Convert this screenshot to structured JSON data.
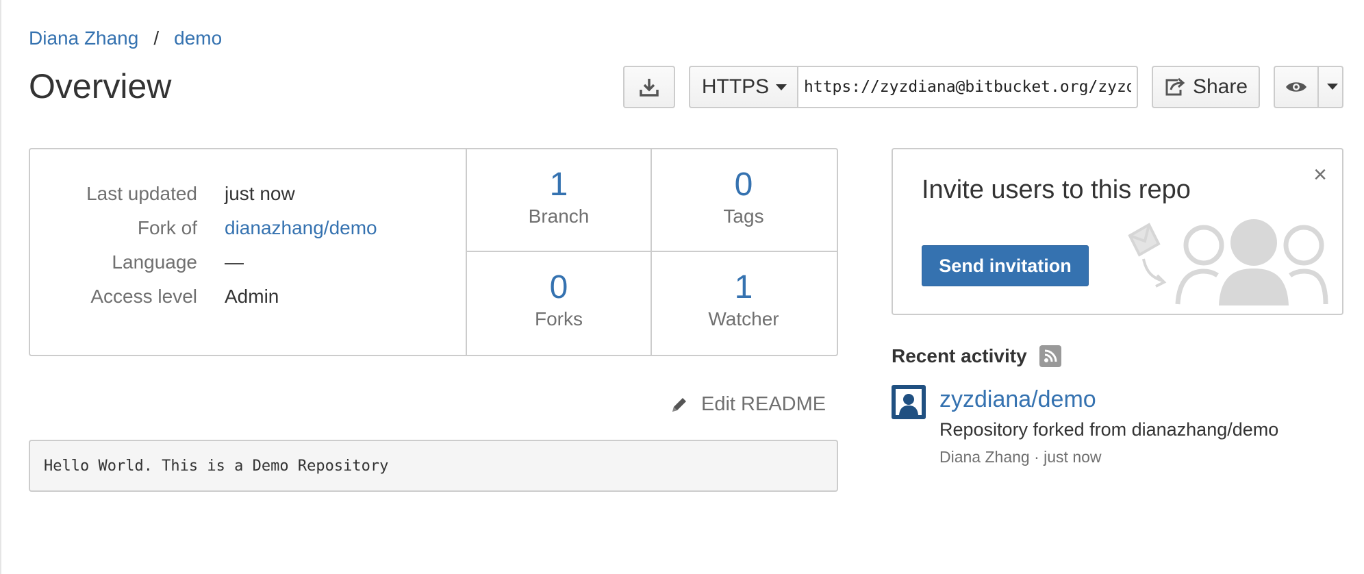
{
  "breadcrumb": {
    "owner": "Diana Zhang",
    "separator": "/",
    "repo": "demo"
  },
  "page_title": "Overview",
  "toolbar": {
    "protocol": "HTTPS",
    "clone_url": "https://zyzdiana@bitbucket.org/zyzdiana/demo.git",
    "share_label": "Share"
  },
  "repo_meta": [
    {
      "label": "Last updated",
      "value": "just now"
    },
    {
      "label": "Fork of",
      "value": "dianazhang/demo"
    },
    {
      "label": "Language",
      "value": "—"
    },
    {
      "label": "Access level",
      "value": "Admin"
    }
  ],
  "stats": [
    {
      "count": "1",
      "label": "Branch"
    },
    {
      "count": "0",
      "label": "Tags"
    },
    {
      "count": "0",
      "label": "Forks"
    },
    {
      "count": "1",
      "label": "Watcher"
    }
  ],
  "readme": {
    "edit_label": "Edit README",
    "content": "Hello World. This is a Demo Repository"
  },
  "invite": {
    "title": "Invite users to this repo",
    "button_label": "Send invitation",
    "close_glyph": "×"
  },
  "activity": {
    "heading": "Recent activity",
    "items": [
      {
        "repo": "zyzdiana/demo",
        "description": "Repository forked from dianazhang/demo",
        "meta": "Diana Zhang · just now"
      }
    ]
  },
  "colors": {
    "link": "#3572b0",
    "primary_button": "#3572b0",
    "avatar": "#205081",
    "border": "#cccccc"
  },
  "icons": [
    "download-icon",
    "caret-down-icon",
    "share-icon",
    "eye-icon",
    "close-icon",
    "pencil-icon",
    "rss-icon",
    "user-avatar-icon",
    "envelope-icon",
    "people-icon"
  ]
}
